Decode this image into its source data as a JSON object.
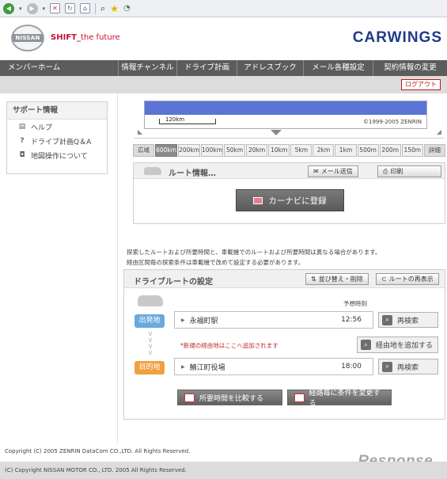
{
  "browser_toolbar": {
    "icons": [
      "back-icon",
      "forward-icon",
      "stop-icon",
      "refresh-icon",
      "home-icon",
      "search-icon",
      "favorites-icon",
      "history-icon"
    ]
  },
  "header": {
    "logo_text": "NISSAN",
    "tagline_shift": "SHIFT_",
    "tagline_rest": "the future",
    "brand": "CARWINGS",
    "brand_color": "#1e3a8a"
  },
  "nav": {
    "items": [
      "メンバーホーム",
      "情報チャンネル",
      "ドライブ計画",
      "アドレスブック",
      "メール各種設定",
      "契約情報の変更"
    ],
    "logout": "ログアウト"
  },
  "sidebar": {
    "title": "サポート情報",
    "items": [
      "ヘルプ",
      "ドライブ計画Q＆A",
      "地図操作について"
    ]
  },
  "map": {
    "scale_label": "120km",
    "copyright": "©1999-2005 ZENRIN"
  },
  "zoom": {
    "levels": [
      "広域",
      "600km",
      "200km",
      "100km",
      "50km",
      "20km",
      "10km",
      "5km",
      "2km",
      "1km",
      "500m",
      "200m",
      "150m",
      "詳細"
    ],
    "selected": "600km"
  },
  "route_info": {
    "title": "ルート情報…",
    "mail_button": "メール送信",
    "print_button": "印刷",
    "navi_button": "カーナビに登録"
  },
  "notes": {
    "line1": "探索したルートおよび所要時間と、車載機でのルートおよび所要時間は異なる場合があります。",
    "line2": "経由区間毎の探索条件は車載機で改めて設定する必要があります。"
  },
  "drive_route": {
    "title": "ドライブルートの設定",
    "sort_button": "並び替え・削除",
    "redisplay_button": "ルートの再表示",
    "eta_label": "予想時刻",
    "start_tag": "出発地",
    "start_name": "永福町駅",
    "start_time": "12:56",
    "search_label": "再検索",
    "via_note": "*新規の経由地はここへ追加されます",
    "add_via": "経由地を追加する",
    "dest_tag": "目的地",
    "dest_name": "鯖江町役場",
    "dest_time": "18:00",
    "compare_button": "所要時間を比較する",
    "change_button": "経路毎に条件を変更する"
  },
  "footer": {
    "copyright1": "Copyright (C) 2005 ZENRIN DataCom CO.,LTD. All Rights Reserved.",
    "copyright2": "(C) Copyright NISSAN MOTOR CO., LTD. 2005 All Rights Reserved.",
    "watermark": "Response."
  }
}
